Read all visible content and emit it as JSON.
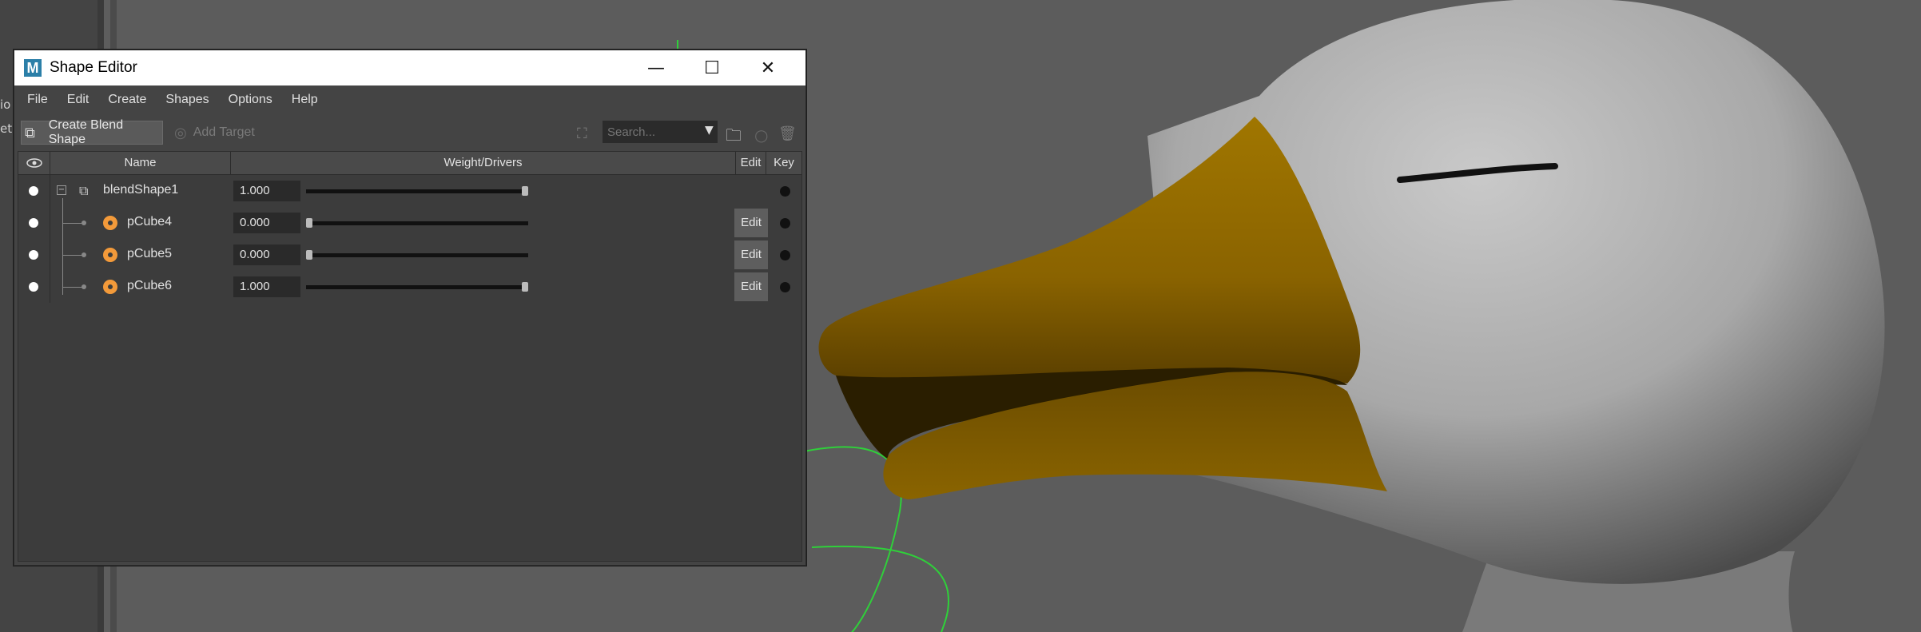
{
  "left_strip": {
    "frag1": "io",
    "frag2": "et"
  },
  "window": {
    "app_icon": "M",
    "title": "Shape Editor",
    "controls": {
      "minimize": "—",
      "maximize": "☐",
      "close": "✕"
    }
  },
  "menus": [
    "File",
    "Edit",
    "Create",
    "Shapes",
    "Options",
    "Help"
  ],
  "toolbar": {
    "create_blend_shape": "Create Blend Shape",
    "add_target": "Add Target",
    "search_placeholder": "Search..."
  },
  "columns": {
    "name": "Name",
    "weight": "Weight/Drivers",
    "edit": "Edit",
    "key": "Key"
  },
  "rows": [
    {
      "name": "blendShape1",
      "weight": "1.000",
      "weight_value": 1.0,
      "has_edit": false
    },
    {
      "name": "pCube4",
      "weight": "0.000",
      "weight_value": 0.0,
      "has_edit": true,
      "edit_label": "Edit"
    },
    {
      "name": "pCube5",
      "weight": "0.000",
      "weight_value": 0.0,
      "has_edit": true,
      "edit_label": "Edit"
    },
    {
      "name": "pCube6",
      "weight": "1.000",
      "weight_value": 1.0,
      "has_edit": true,
      "edit_label": "Edit"
    }
  ],
  "colors": {
    "beak": "#8c6500",
    "head": "#b8b8b8",
    "accent": "#f39a3a",
    "curve": "#2fd03a"
  }
}
